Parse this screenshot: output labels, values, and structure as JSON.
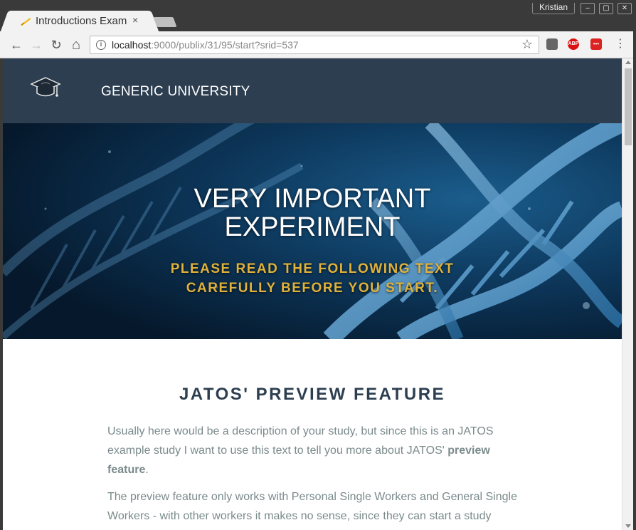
{
  "browser": {
    "tab_title": "Introductions Exam",
    "tab_close": "×",
    "user_name": "Kristian",
    "url_host": "localhost",
    "url_rest": ":9000/publix/31/95/start?srid=537",
    "back_icon": "←",
    "forward_icon": "→",
    "reload_icon": "↻",
    "home_icon": "⌂",
    "star_icon": "☆",
    "adblock_label": "ABP",
    "menu_icon": "⋮"
  },
  "site": {
    "name": "GENERIC UNIVERSITY"
  },
  "hero": {
    "title_line1": "VERY IMPORTANT",
    "title_line2": "EXPERIMENT",
    "subtitle_line1": "PLEASE READ THE FOLLOWING TEXT",
    "subtitle_line2": "CAREFULLY BEFORE YOU START."
  },
  "content": {
    "section_title": "JATOS' PREVIEW FEATURE",
    "p1_text": "Usually here would be a description of your study, but since this is an JATOS example study I want to use this text to tell you more about JATOS' ",
    "p1_bold": "preview feature",
    "p1_end": ".",
    "p2_text": "The preview feature only works with Personal Single Workers and General Single Workers - with other workers it makes no sense, since they can start a study"
  },
  "colors": {
    "nav_bg": "#2c3e50",
    "accent_gold": "#e0b23a",
    "body_text": "#7b8a8b",
    "heading": "#2c3e50"
  }
}
